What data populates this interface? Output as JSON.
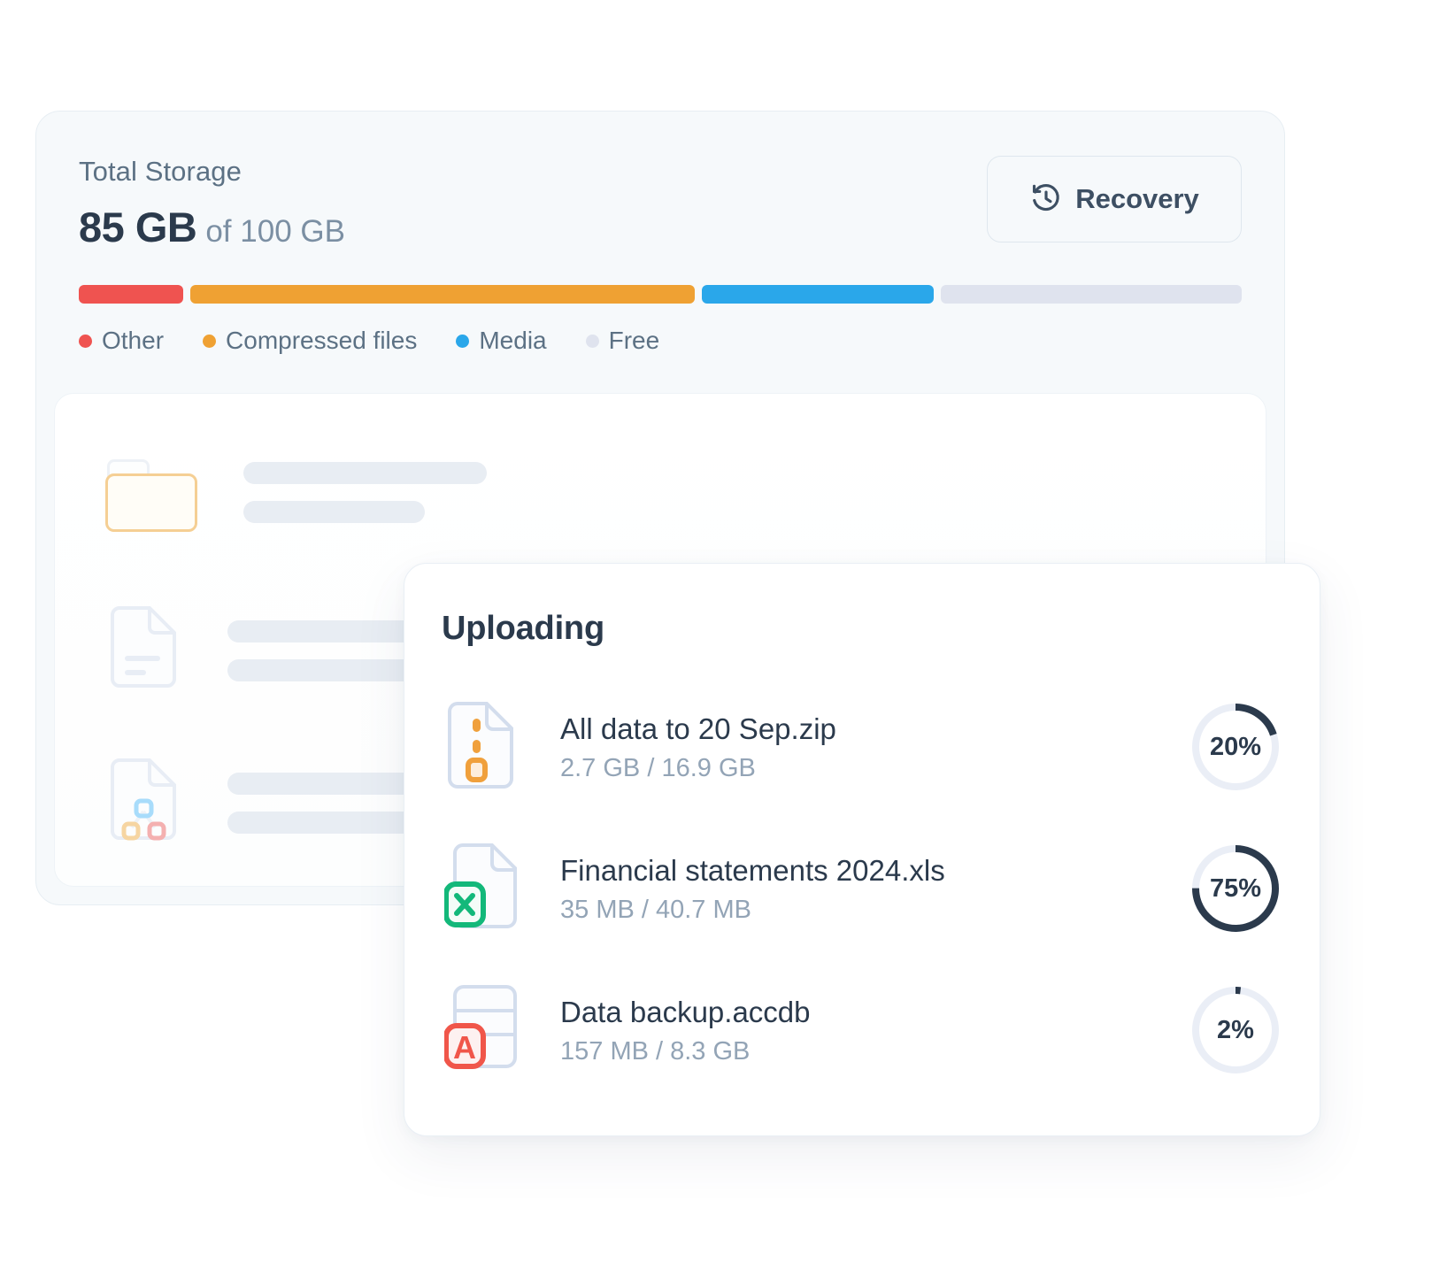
{
  "storage": {
    "title": "Total Storage",
    "used": "85 GB",
    "total": "of 100 GB",
    "recovery_label": "Recovery",
    "segments": [
      {
        "name": "Other",
        "color": "#ef5350",
        "percent": 9
      },
      {
        "name": "Compressed files",
        "color": "#efa133",
        "percent": 43.5
      },
      {
        "name": "Media",
        "color": "#2aa7ea",
        "percent": 20
      },
      {
        "name": "Free",
        "color": "#dfe3ee",
        "percent": 26
      }
    ],
    "legend": [
      {
        "label": "Other",
        "color": "#ef5350"
      },
      {
        "label": "Compressed files",
        "color": "#efa133"
      },
      {
        "label": "Media",
        "color": "#2aa7ea"
      },
      {
        "label": "Free",
        "color": "#dfe3ee"
      }
    ]
  },
  "uploading": {
    "title": "Uploading",
    "files": [
      {
        "name": "All data to 20 Sep.zip",
        "size": "2.7 GB / 16.9 GB",
        "percent": 20,
        "percent_label": "20%",
        "icon": "zip-file-icon",
        "accent": "#f0a03c"
      },
      {
        "name": "Financial statements 2024.xls",
        "size": "35 MB / 40.7 MB",
        "percent": 75,
        "percent_label": "75%",
        "icon": "excel-file-icon",
        "accent": "#13b87a"
      },
      {
        "name": "Data backup.accdb",
        "size": "157 MB / 8.3 GB",
        "percent": 2,
        "percent_label": "2%",
        "icon": "access-database-file-icon",
        "accent": "#f0564a"
      }
    ],
    "ring_track_color": "#eaeef6",
    "ring_fill_color": "#2b3a4c"
  },
  "colors": {
    "text_dark": "#2b3a4c",
    "text_muted": "#5c7184",
    "panel_bg": "#f6f9fb"
  }
}
